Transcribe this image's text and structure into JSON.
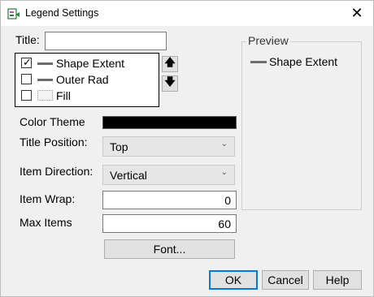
{
  "window": {
    "title": "Legend Settings"
  },
  "title_field": {
    "label": "Title:",
    "value": ""
  },
  "legend_items": [
    {
      "label": "Shape Extent",
      "checked": true,
      "swatch": "line"
    },
    {
      "label": "Outer Rad",
      "checked": false,
      "swatch": "line"
    },
    {
      "label": "Fill",
      "checked": false,
      "swatch": "fill"
    }
  ],
  "check_glyph": "✓",
  "move_up_glyph": "🡅",
  "move_down_glyph": "🡇",
  "color_theme": {
    "label": "Color Theme",
    "color": "#000000"
  },
  "title_position": {
    "label": "Title Position:",
    "value": "Top"
  },
  "item_direction": {
    "label": "Item Direction:",
    "value": "Vertical"
  },
  "item_wrap": {
    "label": "Item Wrap:",
    "value": "0"
  },
  "max_items": {
    "label": "Max Items",
    "value": "60"
  },
  "font_button": "Font...",
  "preview": {
    "title": "Preview",
    "item_label": "Shape Extent"
  },
  "buttons": {
    "ok": "OK",
    "cancel": "Cancel",
    "help": "Help"
  },
  "icons": {
    "app": "legend-app-icon",
    "close": "close-icon",
    "dropdown": "chevron-down-icon"
  }
}
